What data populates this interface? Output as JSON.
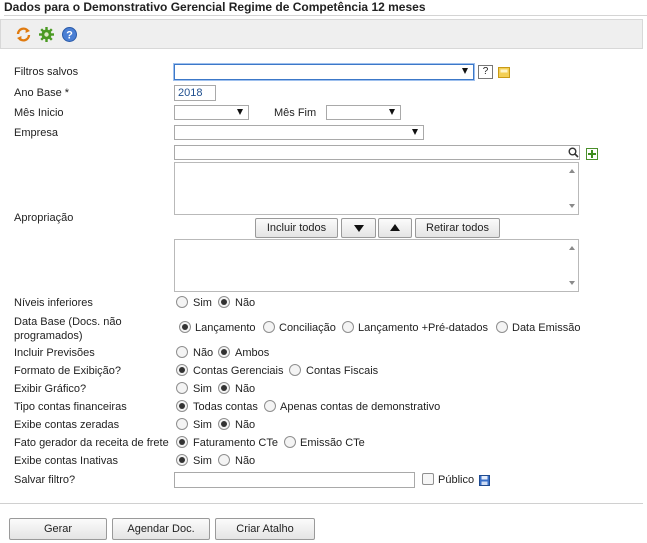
{
  "page": {
    "title": "Dados para o Demonstrativo Gerencial Regime de Competência 12 meses"
  },
  "toolbar": {
    "icons": [
      "refresh-icon",
      "settings-gear-icon",
      "help-icon"
    ]
  },
  "form": {
    "filtros_salvos": {
      "label": "Filtros salvos",
      "value": "",
      "help": "?"
    },
    "ano_base": {
      "label": "Ano Base *",
      "value": "2018"
    },
    "mes_inicio": {
      "label": "Mês Inicio",
      "value": ""
    },
    "mes_fim": {
      "label": "Mês Fim",
      "value": ""
    },
    "empresa": {
      "label": "Empresa",
      "value": ""
    },
    "apropriacao": {
      "label": "Apropriação",
      "search_value": "",
      "buttons": {
        "incluir": "Incluir todos",
        "retirar": "Retirar todos"
      }
    },
    "niveis_inferiores": {
      "label": "Níveis inferiores",
      "options": [
        "Sim",
        "Não"
      ],
      "selected": "Não"
    },
    "data_base": {
      "label_line1": "Data Base (Docs. não",
      "label_line2": "programados)",
      "options": [
        "Lançamento",
        "Conciliação",
        "Lançamento +Pré-datados",
        "Data Emissão"
      ],
      "selected": "Lançamento"
    },
    "incluir_previsoes": {
      "label": "Incluir Previsões",
      "options": [
        "Não",
        "Ambos"
      ],
      "selected": "Ambos"
    },
    "formato_exibicao": {
      "label": "Formato de Exibição?",
      "options": [
        "Contas Gerenciais",
        "Contas Fiscais"
      ],
      "selected": "Contas Gerenciais"
    },
    "exibir_grafico": {
      "label": "Exibir Gráfico?",
      "options": [
        "Sim",
        "Não"
      ],
      "selected": "Não"
    },
    "tipo_contas": {
      "label": "Tipo contas financeiras",
      "options": [
        "Todas contas",
        "Apenas contas de demonstrativo"
      ],
      "selected": "Todas contas"
    },
    "exibe_zeradas": {
      "label": "Exibe contas zeradas",
      "options": [
        "Sim",
        "Não"
      ],
      "selected": "Não"
    },
    "fato_gerador": {
      "label": "Fato gerador da receita de frete",
      "options": [
        "Faturamento CTe",
        "Emissão CTe"
      ],
      "selected": "Faturamento CTe"
    },
    "exibe_inativas": {
      "label": "Exibe contas Inativas",
      "options": [
        "Sim",
        "Não"
      ],
      "selected": "Sim"
    },
    "salvar_filtro": {
      "label": "Salvar filtro?",
      "value": "",
      "publico_label": "Público",
      "publico_checked": false
    }
  },
  "actions": {
    "gerar": "Gerar",
    "agendar": "Agendar Doc.",
    "atalho": "Criar Atalho"
  }
}
